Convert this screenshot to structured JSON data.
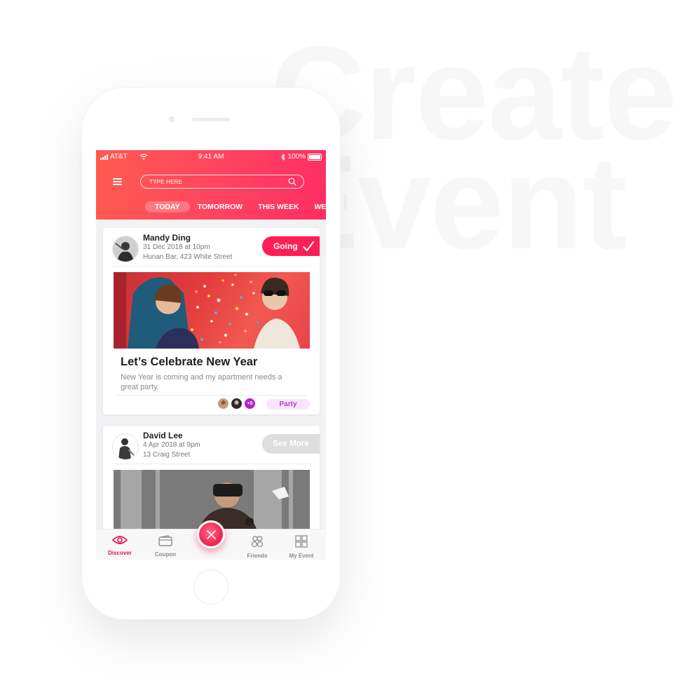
{
  "background": {
    "line1": "Create",
    "line2": "Event"
  },
  "status_bar": {
    "carrier": "AT&T",
    "time": "9:41 AM",
    "battery": "100%"
  },
  "header": {
    "search_placeholder": "TYPE HERE",
    "tabs": [
      {
        "label": "TODAY",
        "active": true
      },
      {
        "label": "TOMORROW",
        "active": false
      },
      {
        "label": "THIS WEEK",
        "active": false
      },
      {
        "label": "WEEKEND",
        "active": false
      }
    ]
  },
  "events": [
    {
      "host": "Mandy Ding",
      "date": "31 Dec 2018 at 10pm",
      "location": "Hunan Bar, 423 White Street",
      "action": "Going",
      "title": "Let’s Celebrate New Year",
      "description": "New Year is coming and my apartment needs a great party.",
      "extra_attendees": "+5",
      "tag": "Party"
    },
    {
      "host": "David Lee",
      "date": "4 Apr 2018 at 9pm",
      "location": "13 Craig Street",
      "action": "See More"
    }
  ],
  "bottom_nav": [
    {
      "label": "Discover",
      "icon": "eye-icon",
      "active": true
    },
    {
      "label": "Coupon",
      "icon": "wallet-icon",
      "active": false
    },
    {
      "label": "Friends",
      "icon": "friends-icon",
      "active": false
    },
    {
      "label": "My Event",
      "icon": "grid-icon",
      "active": false
    }
  ],
  "colors": {
    "accent": "#ff1e56",
    "header_start": "#ff5b4f",
    "header_end": "#ff2d62",
    "tag_text": "#b53ad1",
    "plus_badge": "#b81ed6"
  }
}
